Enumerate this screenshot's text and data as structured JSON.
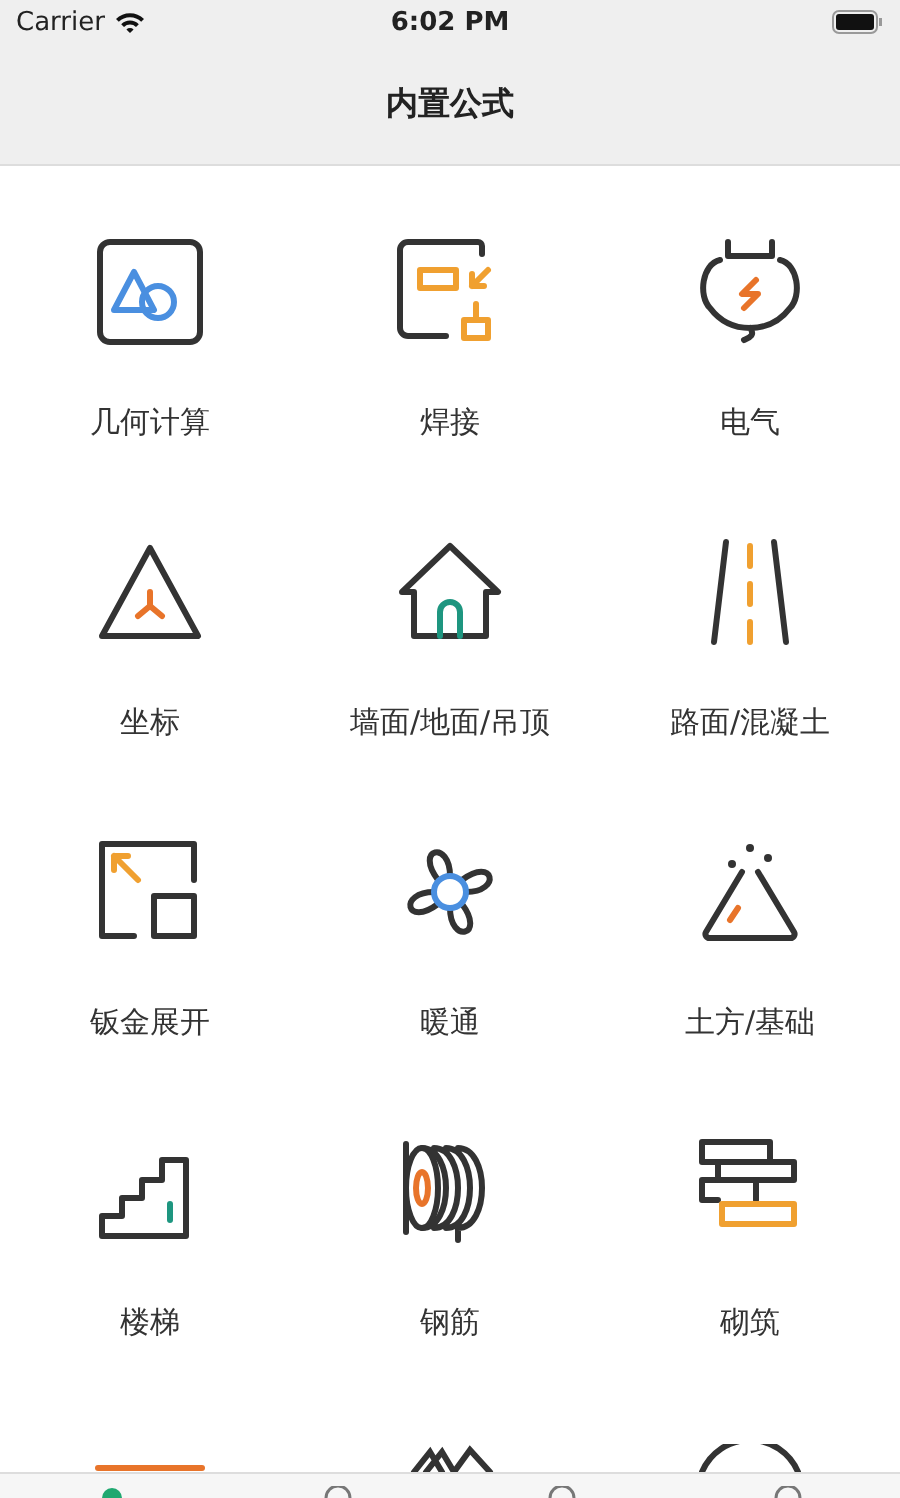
{
  "status_bar": {
    "carrier": "Carrier",
    "time": "6:02 PM"
  },
  "nav_bar": {
    "title": "内置公式"
  },
  "grid": [
    {
      "kind": "geometry",
      "label": "几何计算"
    },
    {
      "kind": "welding",
      "label": "焊接"
    },
    {
      "kind": "electric",
      "label": "电气"
    },
    {
      "kind": "coordinate",
      "label": "坐标"
    },
    {
      "kind": "house",
      "label": "墙面/地面/吊顶"
    },
    {
      "kind": "road",
      "label": "路面/混凝土"
    },
    {
      "kind": "sheet",
      "label": "钣金展开"
    },
    {
      "kind": "fan",
      "label": "暖通"
    },
    {
      "kind": "earth",
      "label": "土方/基础"
    },
    {
      "kind": "stairs",
      "label": "楼梯"
    },
    {
      "kind": "rebar",
      "label": "钢筋"
    },
    {
      "kind": "masonry",
      "label": "砌筑"
    },
    {
      "kind": "beam"
    },
    {
      "kind": "zigzag"
    },
    {
      "kind": "dial"
    }
  ],
  "tab_bar": [
    {
      "selected": true
    },
    {
      "selected": false
    },
    {
      "selected": false
    },
    {
      "selected": false
    }
  ]
}
